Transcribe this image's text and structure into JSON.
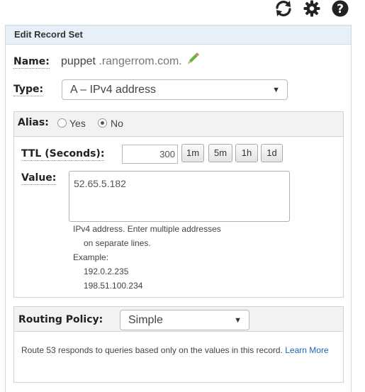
{
  "toolbar": {
    "icons": [
      "refresh-icon",
      "gear-icon",
      "help-icon"
    ]
  },
  "panel": {
    "title": "Edit Record Set"
  },
  "name": {
    "label": "Name:",
    "subdomain": "puppet",
    "domain": " .rangerrom.com."
  },
  "type": {
    "label": "Type:",
    "selected": "A – IPv4 address"
  },
  "alias": {
    "label": "Alias:",
    "options": [
      "Yes",
      "No"
    ],
    "selected": "No"
  },
  "ttl": {
    "label": "TTL (Seconds):",
    "value": "300",
    "presets": [
      "1m",
      "5m",
      "1h",
      "1d"
    ]
  },
  "value": {
    "label": "Value:",
    "content": "52.65.5.182",
    "help_line1": "IPv4 address. Enter multiple addresses",
    "help_line2": "on separate lines.",
    "example_label": "Example:",
    "examples": [
      "192.0.2.235",
      "198.51.100.234"
    ]
  },
  "routing": {
    "label": "Routing Policy:",
    "selected": "Simple",
    "description": "Route 53 responds to queries based only on the values in this record.",
    "link": "Learn More"
  },
  "colors": {
    "header_bg": "#e7eff9",
    "link": "#1a67b5",
    "pencil": "#6db33f"
  }
}
